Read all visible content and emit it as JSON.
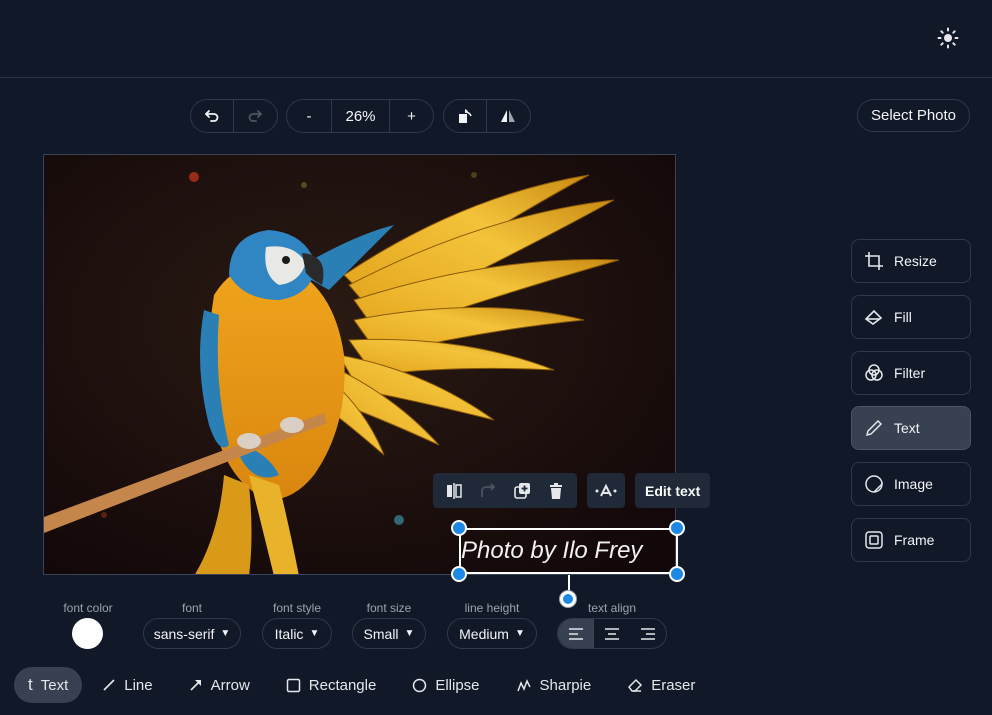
{
  "zoom": {
    "minus_label": "-",
    "value": "26%",
    "plus_label": "+"
  },
  "header": {
    "select_photo_label": "Select Photo"
  },
  "icons": {
    "theme": "sun-icon",
    "undo": "undo-icon",
    "redo": "redo-icon",
    "rotate": "rotate-icon",
    "flip": "flip-icon"
  },
  "text_toolbar": {
    "edit_label": "Edit text"
  },
  "overlay": {
    "text": "Photo by Ilo Frey"
  },
  "sidebar": {
    "items": [
      {
        "label": "Resize",
        "icon": "crop-icon"
      },
      {
        "label": "Fill",
        "icon": "fill-icon"
      },
      {
        "label": "Filter",
        "icon": "filter-icon"
      },
      {
        "label": "Text",
        "icon": "pen-icon",
        "active": true
      },
      {
        "label": "Image",
        "icon": "sticker-icon"
      },
      {
        "label": "Frame",
        "icon": "frame-icon"
      }
    ]
  },
  "props": {
    "font_color_label": "font color",
    "font_color": "#ffffff",
    "font_label": "font",
    "font_value": "sans-serif",
    "font_style_label": "font style",
    "font_style_value": "Italic",
    "font_size_label": "font size",
    "font_size_value": "Small",
    "line_height_label": "line height",
    "line_height_value": "Medium",
    "text_align_label": "text align",
    "text_align_value": "left"
  },
  "tools": [
    {
      "label": "Text",
      "glyph": "t",
      "active": true
    },
    {
      "label": "Line"
    },
    {
      "label": "Arrow"
    },
    {
      "label": "Rectangle"
    },
    {
      "label": "Ellipse"
    },
    {
      "label": "Sharpie"
    },
    {
      "label": "Eraser"
    }
  ],
  "colors": {
    "background": "#111827",
    "accent": "#1d89e4",
    "active": "#374151"
  }
}
